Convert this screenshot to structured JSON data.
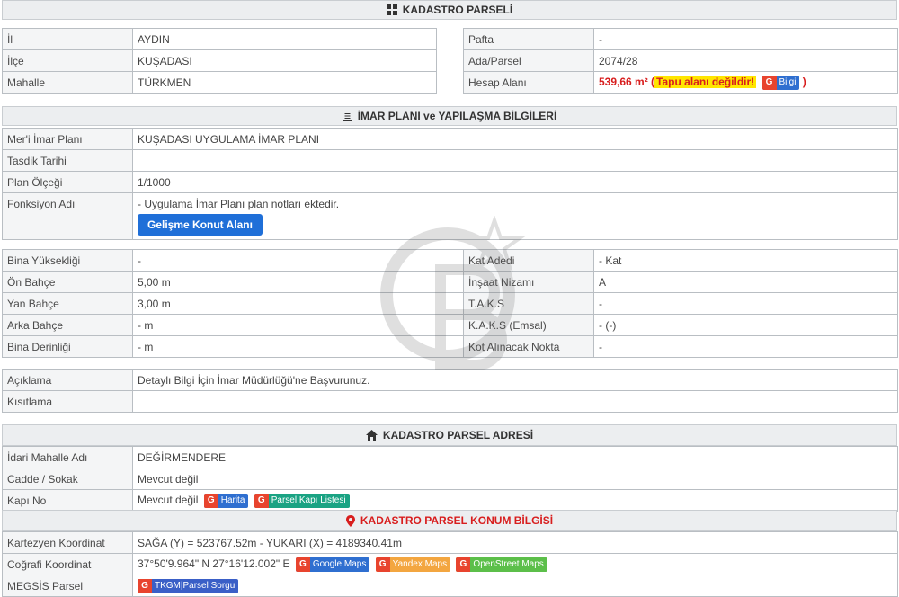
{
  "kadastro": {
    "title": "KADASTRO PARSELİ",
    "left": [
      {
        "key": "İl",
        "value": "AYDIN"
      },
      {
        "key": "İlçe",
        "value": "KUŞADASI"
      },
      {
        "key": "Mahalle",
        "value": "TÜRKMEN"
      }
    ],
    "right": [
      {
        "key": "Pafta",
        "value": "-"
      },
      {
        "key": "Ada/Parsel",
        "value": "2074/28"
      },
      {
        "key": "Hesap Alanı",
        "area": "539,66 m²",
        "open": "(",
        "warning": "Tapu alanı değildir!",
        "info_label": "Bilgi",
        "close": ")"
      }
    ]
  },
  "imar": {
    "title": "İMAR PLANI ve YAPILAŞMA BİLGİLERİ",
    "rows": [
      {
        "key": "Mer'i İmar Planı",
        "value": "KUŞADASI UYGULAMA İMAR PLANI"
      },
      {
        "key": "Tasdik Tarihi",
        "value": ""
      },
      {
        "key": "Plan Ölçeği",
        "value": "1/1000"
      },
      {
        "key": "Fonksiyon Adı",
        "value": "- Uygulama İmar Planı plan notları ektedir.",
        "button": "Gelişme Konut Alanı"
      }
    ],
    "yapi": [
      {
        "key": "Bina Yüksekliği",
        "value": "-",
        "key2": "Kat Adedi",
        "value2": "- Kat"
      },
      {
        "key": "Ön Bahçe",
        "value": "5,00 m",
        "key2": "İnşaat Nizamı",
        "value2": "A"
      },
      {
        "key": "Yan Bahçe",
        "value": "3,00 m",
        "key2": "T.A.K.S",
        "value2": "-"
      },
      {
        "key": "Arka Bahçe",
        "value": "- m",
        "key2": "K.A.K.S (Emsal)",
        "value2": "- (-)"
      },
      {
        "key": "Bina Derinliği",
        "value": "- m",
        "key2": "Kot Alınacak Nokta",
        "value2": "-"
      }
    ],
    "notes": [
      {
        "key": "Açıklama",
        "value": "Detaylı Bilgi İçin İmar Müdürlüğü'ne Başvurunuz."
      },
      {
        "key": "Kısıtlama",
        "value": ""
      }
    ]
  },
  "adres": {
    "title": "KADASTRO PARSEL ADRESİ",
    "rows": [
      {
        "key": "İdari Mahalle Adı",
        "value": "DEĞİRMENDERE"
      },
      {
        "key": "Cadde / Sokak",
        "value": "Mevcut değil"
      },
      {
        "key": "Kapı No",
        "value": "Mevcut değil",
        "chip1": "Harita",
        "chip2": "Parsel Kapı Listesi"
      }
    ]
  },
  "konum": {
    "title": "KADASTRO PARSEL KONUM BİLGİSİ",
    "rows": [
      {
        "key": "Kartezyen Koordinat",
        "value": "SAĞA (Y) = 523767.52m - YUKARI (X) = 4189340.41m"
      },
      {
        "key": "Coğrafi Koordinat",
        "value": "37°50'9.964\" N 27°16'12.002\" E",
        "chip1": "Google Maps",
        "chip2": "Yandex Maps",
        "chip3": "OpenStreet Maps"
      },
      {
        "key": "MEGSİS Parsel",
        "value": "",
        "chip1": "TKGM|Parsel Sorgu"
      }
    ]
  },
  "colors": {
    "accent_red": "#d81e1e",
    "button_blue": "#1f6fd8",
    "warning_yellow": "#ffe600"
  }
}
